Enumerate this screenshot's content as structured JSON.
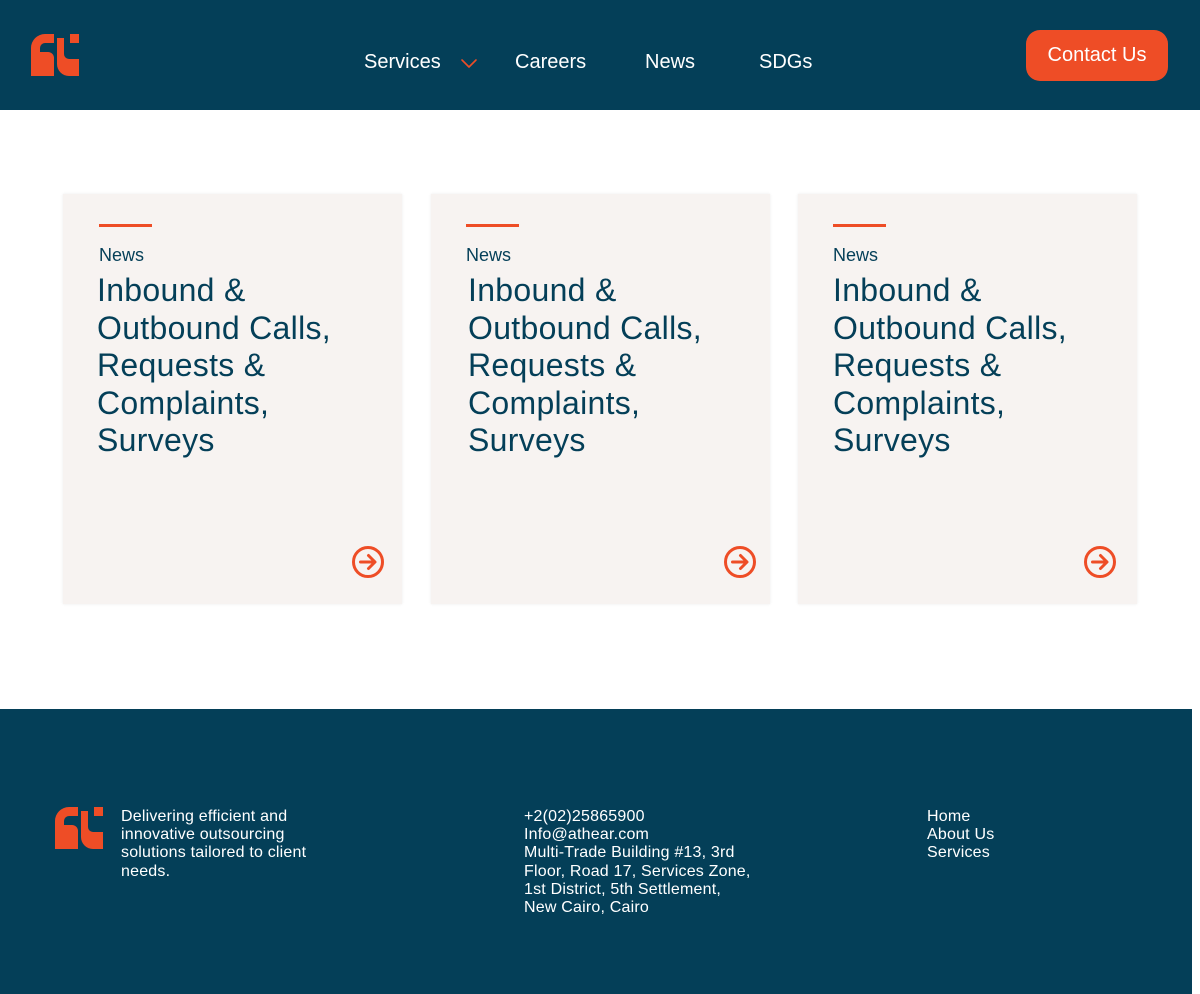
{
  "brand": {
    "logo_icon": "athear-logo-icon",
    "accent_color": "#EE4D26",
    "primary_color": "#043F58",
    "card_background": "#F7F3F1"
  },
  "header": {
    "nav": {
      "services": "Services",
      "careers": "Careers",
      "news": "News",
      "sdgs": "SDGs"
    },
    "contact_label": "Contact Us"
  },
  "cards": [
    {
      "category": "News",
      "title": "Inbound & Outbound Calls, Requests & Complaints, Surveys",
      "arrow_icon": "arrow-right-circle-icon"
    },
    {
      "category": "News",
      "title": "Inbound & Outbound Calls, Requests & Complaints, Surveys",
      "arrow_icon": "arrow-right-circle-icon"
    },
    {
      "category": "News",
      "title": "Inbound & Outbound Calls, Requests & Complaints, Surveys",
      "arrow_icon": "arrow-right-circle-icon"
    }
  ],
  "footer": {
    "tagline_lines": [
      "Delivering efficient and",
      "innovative outsourcing",
      "solutions tailored to client",
      "needs."
    ],
    "contact_lines": [
      "+2(02)25865900",
      "Info@athear.com",
      "Multi-Trade Building #13, 3rd",
      "Floor, Road 17, Services Zone,",
      "1st District, 5th Settlement,",
      "New Cairo, Cairo"
    ],
    "links": [
      "Home",
      "About Us",
      "Services"
    ]
  }
}
